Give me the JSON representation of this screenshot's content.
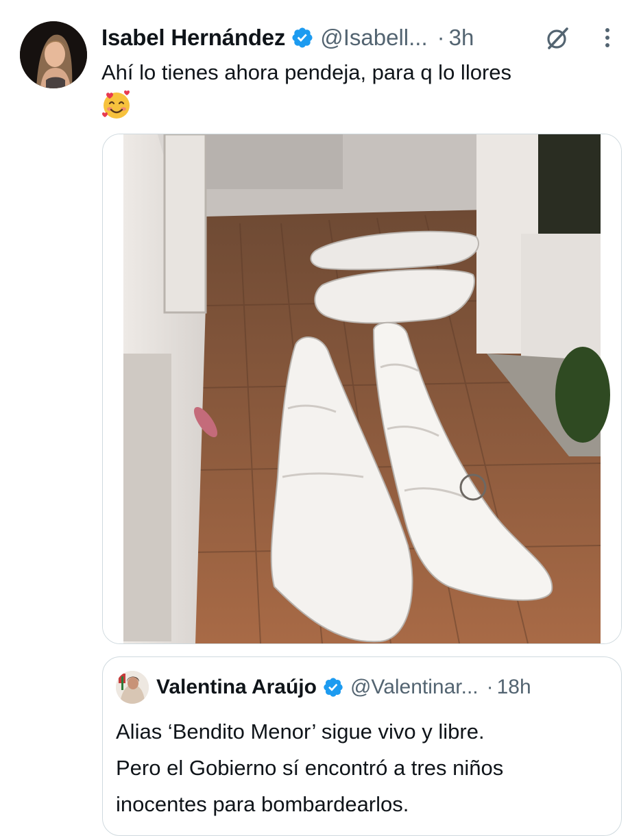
{
  "tweet": {
    "author_name": "Isabel Hernández",
    "author_handle": "@Isabell...",
    "separator": "·",
    "time": "3h",
    "text": "Ahí lo tienes ahora pendeja, para q lo llores",
    "emoji": "smiling-face-with-hearts",
    "avatar_icon": "profile-photo",
    "grok_icon": "grok-icon",
    "more_icon": "more-vertical-icon",
    "verified_icon": "verified-badge",
    "media_alt": "photo"
  },
  "quote": {
    "author_name": "Valentina Araújo",
    "author_handle": "@Valentinar...",
    "separator": "·",
    "time": "18h",
    "text_lines": [
      "Alias ‘Bendito Menor’ sigue vivo y libre.",
      "Pero el Gobierno sí encontró a tres niños",
      "inocentes para bombardearlos."
    ]
  },
  "colors": {
    "text_primary": "#0f1419",
    "text_secondary": "#536471",
    "verified_blue": "#1d9bf0",
    "border": "#cfd9de"
  }
}
